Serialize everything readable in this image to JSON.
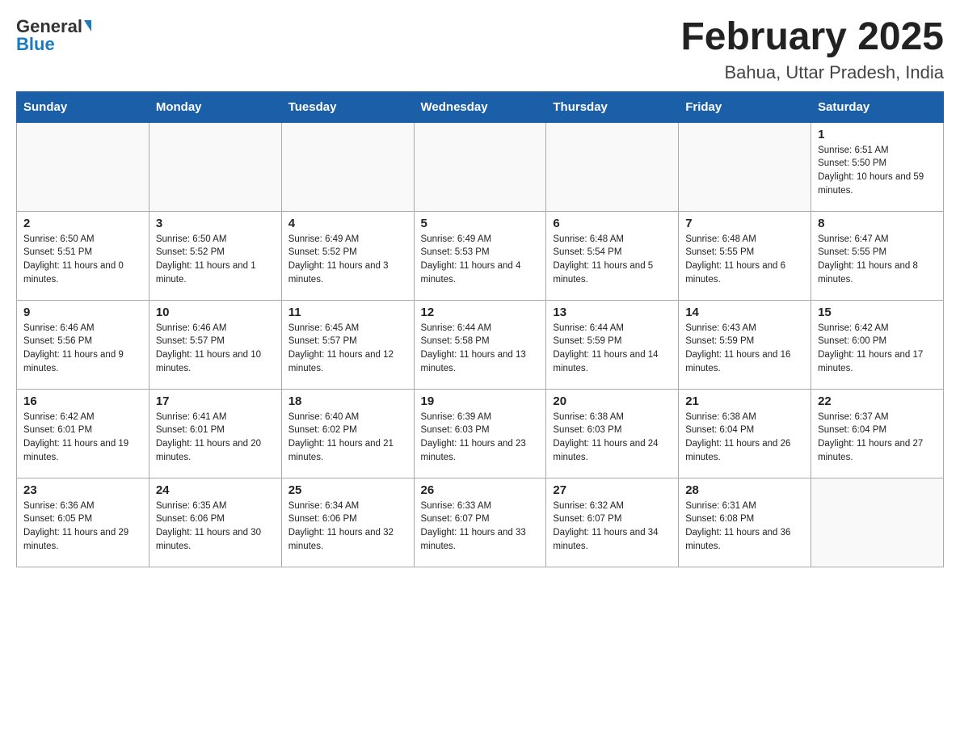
{
  "header": {
    "logo_general": "General",
    "logo_blue": "Blue",
    "title": "February 2025",
    "subtitle": "Bahua, Uttar Pradesh, India"
  },
  "days_of_week": [
    "Sunday",
    "Monday",
    "Tuesday",
    "Wednesday",
    "Thursday",
    "Friday",
    "Saturday"
  ],
  "weeks": [
    {
      "days": [
        {
          "number": "",
          "sunrise": "",
          "sunset": "",
          "daylight": ""
        },
        {
          "number": "",
          "sunrise": "",
          "sunset": "",
          "daylight": ""
        },
        {
          "number": "",
          "sunrise": "",
          "sunset": "",
          "daylight": ""
        },
        {
          "number": "",
          "sunrise": "",
          "sunset": "",
          "daylight": ""
        },
        {
          "number": "",
          "sunrise": "",
          "sunset": "",
          "daylight": ""
        },
        {
          "number": "",
          "sunrise": "",
          "sunset": "",
          "daylight": ""
        },
        {
          "number": "1",
          "sunrise": "Sunrise: 6:51 AM",
          "sunset": "Sunset: 5:50 PM",
          "daylight": "Daylight: 10 hours and 59 minutes."
        }
      ]
    },
    {
      "days": [
        {
          "number": "2",
          "sunrise": "Sunrise: 6:50 AM",
          "sunset": "Sunset: 5:51 PM",
          "daylight": "Daylight: 11 hours and 0 minutes."
        },
        {
          "number": "3",
          "sunrise": "Sunrise: 6:50 AM",
          "sunset": "Sunset: 5:52 PM",
          "daylight": "Daylight: 11 hours and 1 minute."
        },
        {
          "number": "4",
          "sunrise": "Sunrise: 6:49 AM",
          "sunset": "Sunset: 5:52 PM",
          "daylight": "Daylight: 11 hours and 3 minutes."
        },
        {
          "number": "5",
          "sunrise": "Sunrise: 6:49 AM",
          "sunset": "Sunset: 5:53 PM",
          "daylight": "Daylight: 11 hours and 4 minutes."
        },
        {
          "number": "6",
          "sunrise": "Sunrise: 6:48 AM",
          "sunset": "Sunset: 5:54 PM",
          "daylight": "Daylight: 11 hours and 5 minutes."
        },
        {
          "number": "7",
          "sunrise": "Sunrise: 6:48 AM",
          "sunset": "Sunset: 5:55 PM",
          "daylight": "Daylight: 11 hours and 6 minutes."
        },
        {
          "number": "8",
          "sunrise": "Sunrise: 6:47 AM",
          "sunset": "Sunset: 5:55 PM",
          "daylight": "Daylight: 11 hours and 8 minutes."
        }
      ]
    },
    {
      "days": [
        {
          "number": "9",
          "sunrise": "Sunrise: 6:46 AM",
          "sunset": "Sunset: 5:56 PM",
          "daylight": "Daylight: 11 hours and 9 minutes."
        },
        {
          "number": "10",
          "sunrise": "Sunrise: 6:46 AM",
          "sunset": "Sunset: 5:57 PM",
          "daylight": "Daylight: 11 hours and 10 minutes."
        },
        {
          "number": "11",
          "sunrise": "Sunrise: 6:45 AM",
          "sunset": "Sunset: 5:57 PM",
          "daylight": "Daylight: 11 hours and 12 minutes."
        },
        {
          "number": "12",
          "sunrise": "Sunrise: 6:44 AM",
          "sunset": "Sunset: 5:58 PM",
          "daylight": "Daylight: 11 hours and 13 minutes."
        },
        {
          "number": "13",
          "sunrise": "Sunrise: 6:44 AM",
          "sunset": "Sunset: 5:59 PM",
          "daylight": "Daylight: 11 hours and 14 minutes."
        },
        {
          "number": "14",
          "sunrise": "Sunrise: 6:43 AM",
          "sunset": "Sunset: 5:59 PM",
          "daylight": "Daylight: 11 hours and 16 minutes."
        },
        {
          "number": "15",
          "sunrise": "Sunrise: 6:42 AM",
          "sunset": "Sunset: 6:00 PM",
          "daylight": "Daylight: 11 hours and 17 minutes."
        }
      ]
    },
    {
      "days": [
        {
          "number": "16",
          "sunrise": "Sunrise: 6:42 AM",
          "sunset": "Sunset: 6:01 PM",
          "daylight": "Daylight: 11 hours and 19 minutes."
        },
        {
          "number": "17",
          "sunrise": "Sunrise: 6:41 AM",
          "sunset": "Sunset: 6:01 PM",
          "daylight": "Daylight: 11 hours and 20 minutes."
        },
        {
          "number": "18",
          "sunrise": "Sunrise: 6:40 AM",
          "sunset": "Sunset: 6:02 PM",
          "daylight": "Daylight: 11 hours and 21 minutes."
        },
        {
          "number": "19",
          "sunrise": "Sunrise: 6:39 AM",
          "sunset": "Sunset: 6:03 PM",
          "daylight": "Daylight: 11 hours and 23 minutes."
        },
        {
          "number": "20",
          "sunrise": "Sunrise: 6:38 AM",
          "sunset": "Sunset: 6:03 PM",
          "daylight": "Daylight: 11 hours and 24 minutes."
        },
        {
          "number": "21",
          "sunrise": "Sunrise: 6:38 AM",
          "sunset": "Sunset: 6:04 PM",
          "daylight": "Daylight: 11 hours and 26 minutes."
        },
        {
          "number": "22",
          "sunrise": "Sunrise: 6:37 AM",
          "sunset": "Sunset: 6:04 PM",
          "daylight": "Daylight: 11 hours and 27 minutes."
        }
      ]
    },
    {
      "days": [
        {
          "number": "23",
          "sunrise": "Sunrise: 6:36 AM",
          "sunset": "Sunset: 6:05 PM",
          "daylight": "Daylight: 11 hours and 29 minutes."
        },
        {
          "number": "24",
          "sunrise": "Sunrise: 6:35 AM",
          "sunset": "Sunset: 6:06 PM",
          "daylight": "Daylight: 11 hours and 30 minutes."
        },
        {
          "number": "25",
          "sunrise": "Sunrise: 6:34 AM",
          "sunset": "Sunset: 6:06 PM",
          "daylight": "Daylight: 11 hours and 32 minutes."
        },
        {
          "number": "26",
          "sunrise": "Sunrise: 6:33 AM",
          "sunset": "Sunset: 6:07 PM",
          "daylight": "Daylight: 11 hours and 33 minutes."
        },
        {
          "number": "27",
          "sunrise": "Sunrise: 6:32 AM",
          "sunset": "Sunset: 6:07 PM",
          "daylight": "Daylight: 11 hours and 34 minutes."
        },
        {
          "number": "28",
          "sunrise": "Sunrise: 6:31 AM",
          "sunset": "Sunset: 6:08 PM",
          "daylight": "Daylight: 11 hours and 36 minutes."
        },
        {
          "number": "",
          "sunrise": "",
          "sunset": "",
          "daylight": ""
        }
      ]
    }
  ]
}
